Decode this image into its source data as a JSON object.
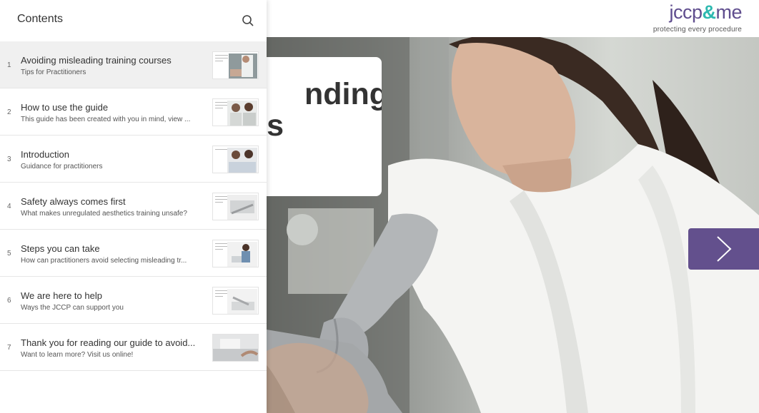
{
  "brand": {
    "logo_prefix": "jccp",
    "logo_amp": "&",
    "logo_suffix": "me",
    "tagline": "protecting every procedure",
    "colors": {
      "primary": "#63508d",
      "accent": "#2eb9b0"
    }
  },
  "sidebar": {
    "title": "Contents",
    "search_icon": "search-icon",
    "items": [
      {
        "num": "1",
        "title": "Avoiding misleading training courses",
        "subtitle": "Tips for Practitioners"
      },
      {
        "num": "2",
        "title": "How to use the guide",
        "subtitle": "This guide has been created with you in mind, view ..."
      },
      {
        "num": "3",
        "title": "Introduction",
        "subtitle": "Guidance for practitioners"
      },
      {
        "num": "4",
        "title": "Safety always comes first",
        "subtitle": "What makes unregulated aesthetics training unsafe?"
      },
      {
        "num": "5",
        "title": "Steps you can take",
        "subtitle": "How can practitioners avoid selecting misleading tr..."
      },
      {
        "num": "6",
        "title": "We are here to help",
        "subtitle": "Ways the JCCP can support you"
      },
      {
        "num": "7",
        "title": "Thank you for reading our guide to avoid...",
        "subtitle": "Want to learn more? Visit us online!"
      }
    ]
  },
  "hero": {
    "title_line1": "nding",
    "title_line2": "s",
    "next_icon": "chevron-right-icon"
  }
}
